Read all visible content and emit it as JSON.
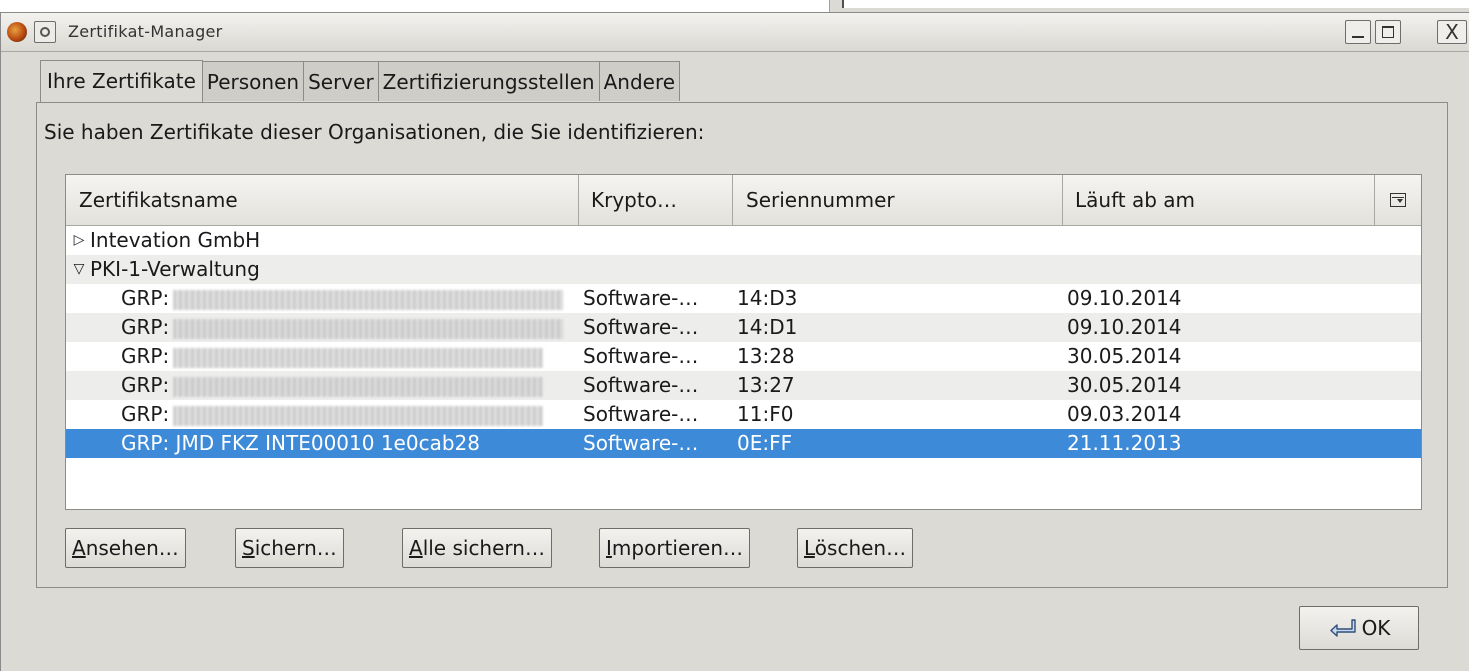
{
  "window": {
    "title": "Zertifikat-Manager",
    "close_glyph": "X"
  },
  "tabs": [
    {
      "label": "Ihre Zertifikate",
      "active": true
    },
    {
      "label": "Personen",
      "active": false
    },
    {
      "label": "Server",
      "active": false
    },
    {
      "label": "Zertifizierungsstellen",
      "active": false
    },
    {
      "label": "Andere",
      "active": false
    }
  ],
  "panel": {
    "description": "Sie haben Zertifikate dieser Organisationen, die Sie identifizieren:"
  },
  "table": {
    "columns": [
      "Zertifikatsname",
      "Krypto…",
      "Seriennummer",
      "Läuft ab am"
    ],
    "groups": [
      {
        "name": "Intevation GmbH",
        "expanded": false,
        "twisty": "▷"
      },
      {
        "name": "PKI-1-Verwaltung",
        "expanded": true,
        "twisty": "▽"
      }
    ],
    "rows": [
      {
        "name_prefix": "GRP:",
        "name": "",
        "crypto": "Software-…",
        "serial": "14:D3",
        "expires": "09.10.2014"
      },
      {
        "name_prefix": "GRP:",
        "name": "",
        "crypto": "Software-…",
        "serial": "14:D1",
        "expires": "09.10.2014"
      },
      {
        "name_prefix": "GRP:",
        "name": "",
        "crypto": "Software-…",
        "serial": "13:28",
        "expires": "30.05.2014"
      },
      {
        "name_prefix": "GRP:",
        "name": "",
        "crypto": "Software-…",
        "serial": "13:27",
        "expires": "30.05.2014"
      },
      {
        "name_prefix": "GRP:",
        "name": "",
        "crypto": "Software-…",
        "serial": "11:F0",
        "expires": "09.03.2014"
      },
      {
        "name_prefix": "",
        "name": "GRP: JMD FKZ INTE00010 1e0cab28",
        "crypto": "Software-…",
        "serial": "0E:FF",
        "expires": "21.11.2013",
        "selected": true
      }
    ]
  },
  "buttons": {
    "view": {
      "mnemonic": "A",
      "rest": "nsehen…"
    },
    "backup": {
      "mnemonic": "S",
      "rest": "ichern…"
    },
    "backup_all": {
      "mnemonic": "A",
      "rest": "lle sichern…"
    },
    "import": {
      "mnemonic": "I",
      "rest": "mportieren…"
    },
    "delete": {
      "mnemonic": "L",
      "rest": "öschen…"
    },
    "ok": "OK"
  },
  "colors": {
    "selection": "#3d8ad8",
    "dialog_bg": "#dcdad5"
  }
}
